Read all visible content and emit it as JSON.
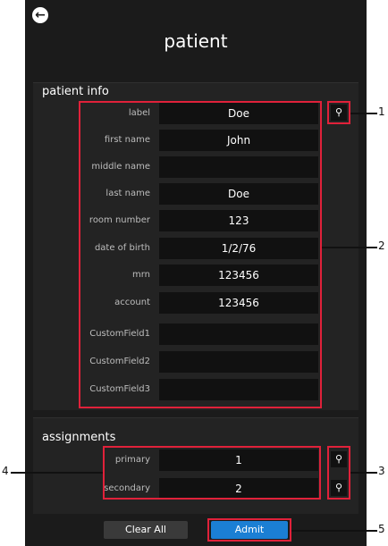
{
  "header": {
    "back_icon": "arrow-left-circle-icon",
    "title": "patient"
  },
  "patient_info": {
    "title": "patient info",
    "fields": [
      {
        "label": "label",
        "value": "Doe"
      },
      {
        "label": "first name",
        "value": "John"
      },
      {
        "label": "middle name",
        "value": ""
      },
      {
        "label": "last name",
        "value": "Doe"
      },
      {
        "label": "room number",
        "value": "123"
      },
      {
        "label": "date of birth",
        "value": "1/2/76"
      },
      {
        "label": "mrn",
        "value": "123456"
      },
      {
        "label": "account",
        "value": "123456"
      },
      {
        "label": "CustomField1",
        "value": ""
      },
      {
        "label": "CustomField2",
        "value": ""
      },
      {
        "label": "CustomField3",
        "value": ""
      }
    ]
  },
  "assignments": {
    "title": "assignments",
    "fields": [
      {
        "label": "primary",
        "value": "1"
      },
      {
        "label": "secondary",
        "value": "2"
      }
    ]
  },
  "buttons": {
    "clear_all": "Clear All",
    "admit": "Admit"
  },
  "callouts": [
    "1",
    "2",
    "3",
    "4",
    "5"
  ],
  "icons": {
    "lookup": "magnifier-icon"
  },
  "colors": {
    "highlight": "#e0213a",
    "accent": "#1b7fd4",
    "panel": "#1b1b1b"
  }
}
